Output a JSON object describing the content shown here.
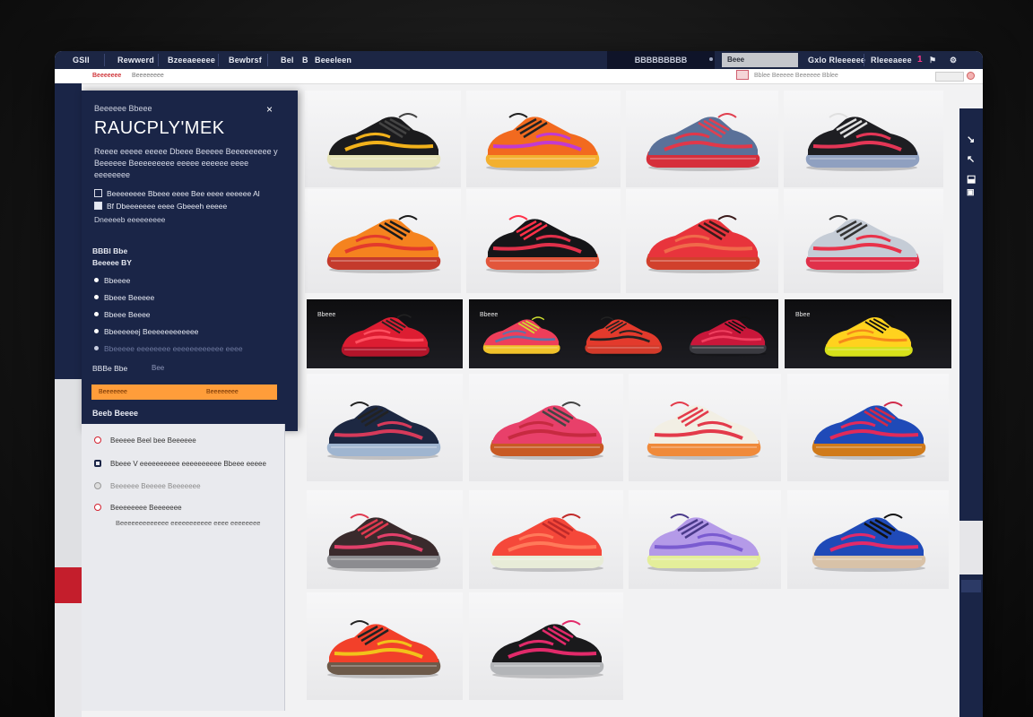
{
  "topnav": {
    "items": [
      "GSII",
      "Rewwerd",
      "Bzeeaeeeee",
      "Bewbrsf",
      "Bel",
      "B",
      "Beeeleen"
    ],
    "search": "BBBBBBBBB",
    "pill": "Beee",
    "account": "Gxlo Rleeeeee",
    "cart": "Rleeeaeee",
    "cart_count": "1"
  },
  "subbar": {
    "active_crumb": "Beeeeeee",
    "crumb": "Beeeeeeee",
    "right_text": "Bblee Beeeee Beeeeee Bblee"
  },
  "panel": {
    "kicker": "Beeeeee Bbeee",
    "close": "×",
    "title": "RAUCPLY'MEK",
    "description": "Reeee eeeee eeeee Dbeee Beeeee Beeeeeeeee y Beeeeee Beeeeeeeee eeeee eeeeee eeee eeeeeeee",
    "checks": [
      {
        "label": "Beeeeeeee Bbeee eeee Bee eeee eeeeee Al",
        "checked": false
      },
      {
        "label": "Bf Dbeeeeeee eeee Gbeeeh eeeee",
        "checked": true
      }
    ],
    "check_sub": "Dneeeeb eeeeeeeee",
    "section_label": [
      "BBBl Bbe",
      "Beeeee BY"
    ],
    "bullets": [
      "Bbeeee",
      "Bbeee Beeeee",
      "Bbeee Beeee",
      "Bbeeeeeej Beeeeeeeeeeee",
      "Bbeeeee eeeeeeee eeeeeeeeeeee eeee"
    ],
    "size_label": "BBBe Bbe",
    "size_value": "Bee",
    "apply_left": "Beeeeeee",
    "apply_right": "Beeeeeeee",
    "more_label": "Beeb Beeee"
  },
  "options": [
    {
      "label": "Beeeee Beel bee Beeeeee",
      "icon": "radio-red-icon"
    },
    {
      "label": "Bbeee V eeeeeeeeee eeeeeeeeee Bbeee eeeee",
      "icon": "square-navy-icon"
    },
    {
      "label": "Beeeeee Beeeee Beeeeeee",
      "icon": "radio-grey-icon"
    },
    {
      "label": "Beeeeeeee Beeeeeee",
      "icon": "radio-red-icon"
    }
  ],
  "option_note": "Beeeeeeeeeeeee eeeeeeeeeee eeee eeeeeeee",
  "banners": [
    "Bbeee",
    "Bbeee",
    "Bbee"
  ],
  "products": [
    {
      "upper": "#1b1b1d",
      "accent": "#f2b21b",
      "sole": "#e6e4b8",
      "laces": "#444"
    },
    {
      "upper": "#f26a1f",
      "accent": "#c23ad0",
      "sole": "#f3b02f",
      "laces": "#222"
    },
    {
      "upper": "#5a7199",
      "accent": "#e0384a",
      "sole": "#d62f3b",
      "laces": "#e04050"
    },
    {
      "upper": "#1e1e22",
      "accent": "#e43656",
      "sole": "#8fa0c0",
      "laces": "#e0e0e0"
    },
    {
      "upper": "#f5831f",
      "accent": "#e33a2c",
      "sole": "#c43a2c",
      "laces": "#1a1a1a"
    },
    {
      "upper": "#151518",
      "accent": "#e0304a",
      "sole": "#e2563b",
      "laces": "#ff3048"
    },
    {
      "upper": "#e8343c",
      "accent": "#f06a4a",
      "sole": "#d1402c",
      "laces": "#3a1a1a"
    },
    {
      "upper": "#c5ccd6",
      "accent": "#e8324a",
      "sole": "#e0304a",
      "laces": "#333"
    },
    {
      "upper": "#dd1d32",
      "accent": "#ff5060",
      "sole": "#b3152a",
      "laces": "#222"
    },
    {
      "upper": "#ee3e5a",
      "accent": "#5a74aa",
      "sole": "#f0c22a",
      "laces": "#d0e030"
    },
    {
      "upper": "#e33a2c",
      "accent": "#222",
      "sole": "#d23a2a",
      "laces": "#222"
    },
    {
      "upper": "#c9173a",
      "accent": "#f04060",
      "sole": "#3a3a40",
      "laces": "#111"
    },
    {
      "upper": "#ffd21e",
      "accent": "#f58a1a",
      "sole": "#d6e01a",
      "laces": "#111"
    },
    {
      "upper": "#1d2842",
      "accent": "#d63a5a",
      "sole": "#9fb5d0",
      "laces": "#222"
    },
    {
      "upper": "#e8406a",
      "accent": "#c62a40",
      "sole": "#c85a24",
      "laces": "#444"
    },
    {
      "upper": "#f2efe4",
      "accent": "#e33a4a",
      "sole": "#f08a3a",
      "laces": "#e33a4a"
    },
    {
      "upper": "#1f4ab8",
      "accent": "#e22a5a",
      "sole": "#d07a1a",
      "laces": "#d02a4a"
    },
    {
      "upper": "#3a2a2c",
      "accent": "#e2406a",
      "sole": "#8c8c90",
      "laces": "#e03a50"
    },
    {
      "upper": "#f5483a",
      "accent": "#ff7a5a",
      "sole": "#e8ecd8",
      "laces": "#c02a2a"
    },
    {
      "upper": "#b49ae8",
      "accent": "#7a5bd0",
      "sole": "#e4ee9a",
      "laces": "#4a3a8a"
    },
    {
      "upper": "#1f4ab8",
      "accent": "#e22a6a",
      "sole": "#d8c2a8",
      "laces": "#111"
    },
    {
      "upper": "#f2402a",
      "accent": "#f2c21a",
      "sole": "#6d5a4a",
      "laces": "#222"
    },
    {
      "upper": "#1a1a1c",
      "accent": "#e22a6a",
      "sole": "#b3b5b8",
      "laces": "#e22a6a"
    }
  ],
  "icons": {
    "close": "close-icon",
    "cart_badge": "cart-badge"
  }
}
